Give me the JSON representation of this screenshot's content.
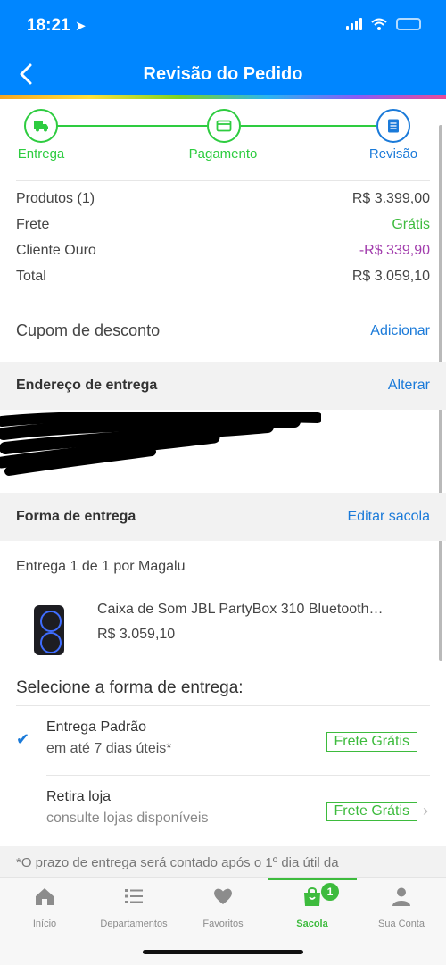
{
  "status": {
    "time": "18:21"
  },
  "header": {
    "title": "Revisão do Pedido"
  },
  "steps": [
    {
      "label": "Entrega",
      "icon": "truck-icon"
    },
    {
      "label": "Pagamento",
      "icon": "card-icon"
    },
    {
      "label": "Revisão",
      "icon": "document-icon"
    }
  ],
  "summary": {
    "products_label": "Produtos (1)",
    "products_value": "R$ 3.399,00",
    "shipping_label": "Frete",
    "shipping_value": "Grátis",
    "gold_label": "Cliente Ouro",
    "gold_value": "-R$ 339,90",
    "total_label": "Total",
    "total_value": "R$ 3.059,10"
  },
  "coupon": {
    "label": "Cupom de desconto",
    "action": "Adicionar"
  },
  "address": {
    "heading": "Endereço de entrega",
    "action": "Alterar"
  },
  "delivery": {
    "heading": "Forma de entrega",
    "action": "Editar sacola",
    "by": "Entrega 1 de 1 por Magalu",
    "product_name": "Caixa de Som JBL PartyBox 310 Bluetooth…",
    "product_price": "R$ 3.059,10",
    "select_title": "Selecione a forma de entrega:",
    "options": [
      {
        "title": "Entrega Padrão",
        "subtitle": "em até 7 dias úteis*",
        "badge": "Frete Grátis"
      },
      {
        "title": "Retira loja",
        "subtitle": "consulte lojas disponíveis",
        "badge": "Frete Grátis"
      }
    ],
    "note": "*O prazo de entrega será contado após o 1º dia útil da"
  },
  "tabbar": {
    "items": [
      {
        "label": "Início",
        "icon": "home-icon"
      },
      {
        "label": "Departamentos",
        "icon": "list-icon"
      },
      {
        "label": "Favoritos",
        "icon": "heart-icon"
      },
      {
        "label": "Sacola",
        "icon": "bag-icon",
        "badge": "1"
      },
      {
        "label": "Sua Conta",
        "icon": "user-icon"
      }
    ]
  },
  "colors": {
    "brand_blue": "#0086ff",
    "link": "#1a7ad9",
    "success": "#3dbb3d",
    "discount": "#a23dad"
  }
}
